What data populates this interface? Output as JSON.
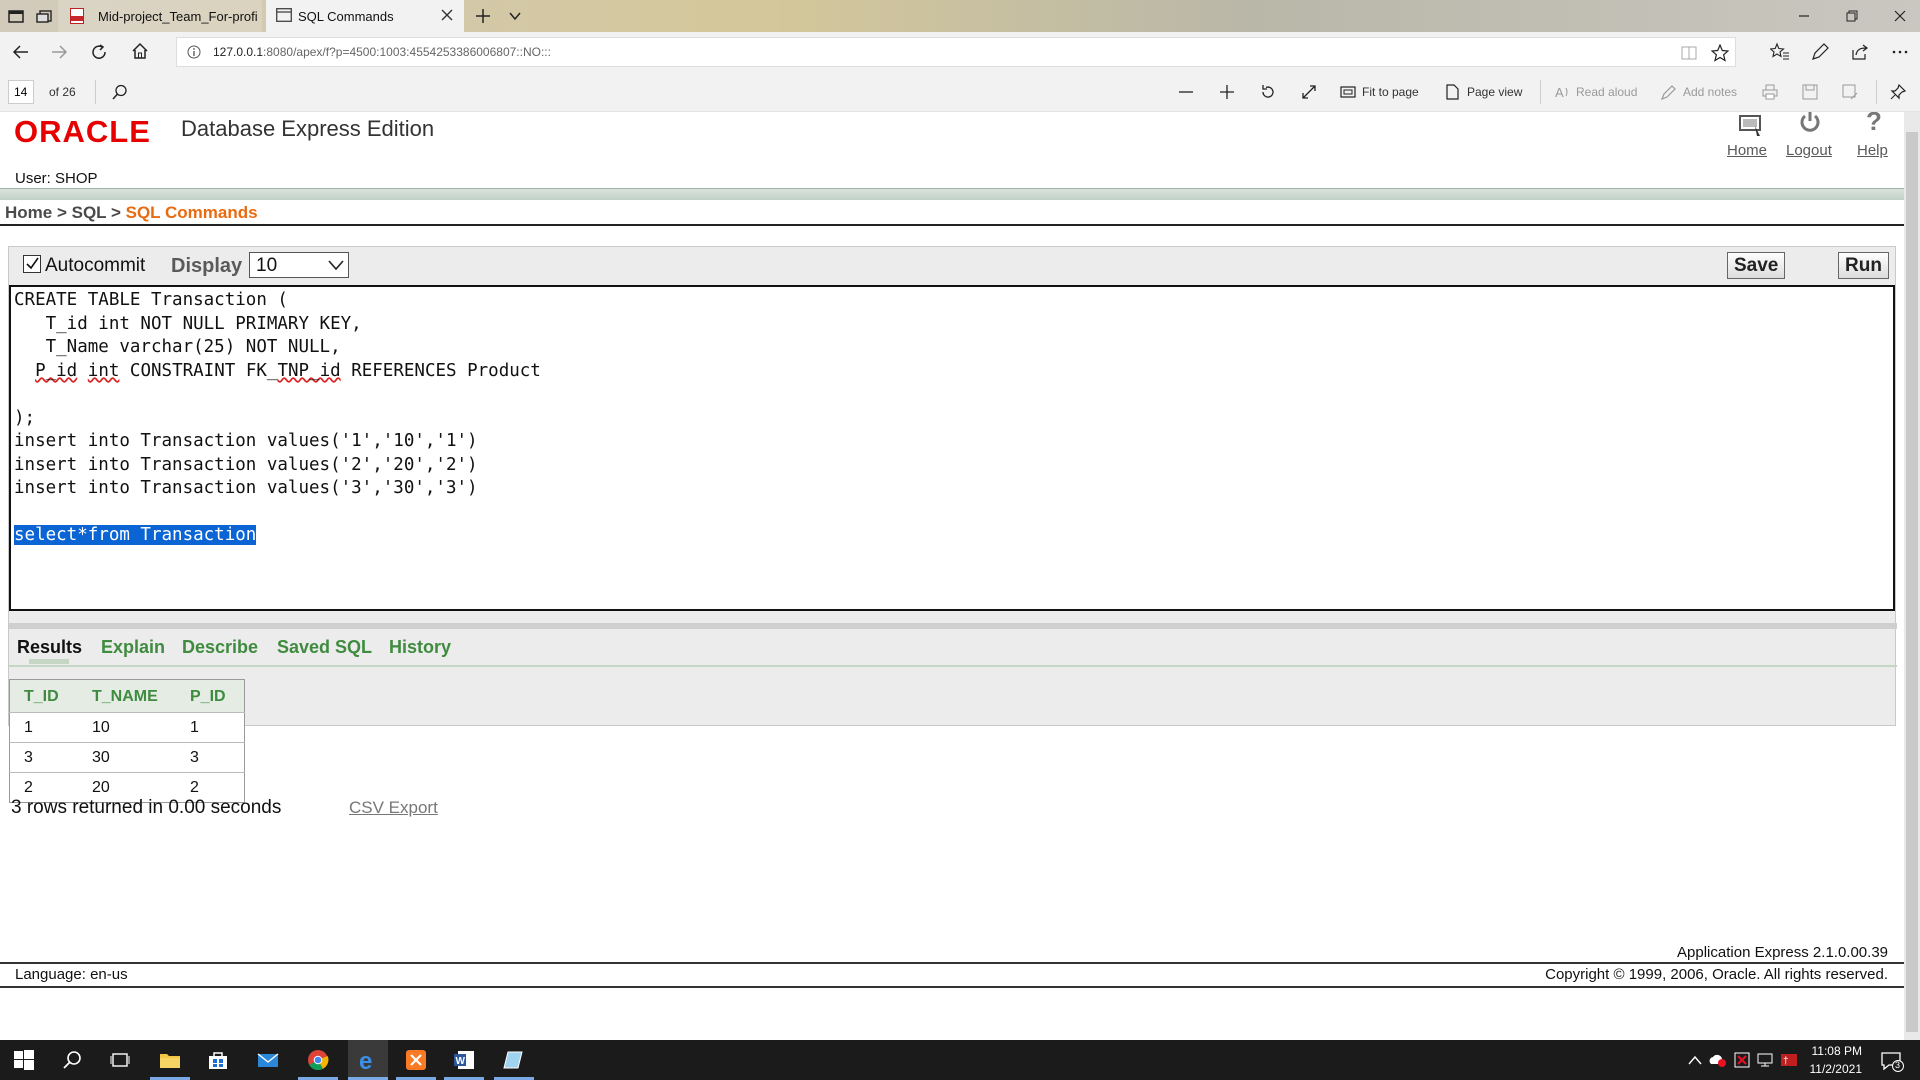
{
  "browser": {
    "tabs": [
      {
        "label": "Mid-project_Team_For-profi"
      },
      {
        "label": "SQL Commands"
      }
    ],
    "url_host": "127.0.0.1",
    "url_rest": ":8080/apex/f?p=4500:1003:4554253386006807::NO:::"
  },
  "pdf_toolbar": {
    "page": "14",
    "of_pages": "of 26",
    "fit_to_page": "Fit to page",
    "page_view": "Page view",
    "read_aloud": "Read aloud",
    "add_notes": "Add notes"
  },
  "header": {
    "logo": "ORACLE",
    "product": "Database Express Edition",
    "links": {
      "home": "Home",
      "logout": "Logout",
      "help": "Help"
    },
    "user": "User: SHOP"
  },
  "breadcrumb": {
    "home": "Home",
    "sep": " > ",
    "sql": "SQL",
    "current": "SQL Commands"
  },
  "command_panel": {
    "autocommit_label": "Autocommit",
    "autocommit_checked": true,
    "display_label": "Display",
    "display_value": "10",
    "save_label": "Save",
    "run_label": "Run",
    "code": {
      "line1": "CREATE TABLE Transaction (",
      "line2": "   T_id int NOT NULL PRIMARY KEY,",
      "line3": "   T_Name varchar(25) NOT NULL,",
      "line4_a": "  ",
      "line4_p_id": "P_id",
      "line4_sp": " ",
      "line4_int": "int",
      "line4_mid": " CONSTRAINT FK_",
      "line4_tnp": "TNP_id",
      "line4_end": " REFERENCES Product",
      "line5": ");",
      "line6": "insert into Transaction values('1','10','1')",
      "line7": "insert into Transaction values('2','20','2')",
      "line8": "insert into Transaction values('3','30','3')",
      "line9": "select*from Transaction"
    }
  },
  "results_tabs": {
    "results": "Results",
    "explain": "Explain",
    "describe": "Describe",
    "saved_sql": "Saved SQL",
    "history": "History"
  },
  "results": {
    "columns": [
      "T_ID",
      "T_NAME",
      "P_ID"
    ],
    "rows": [
      [
        "1",
        "10",
        "1"
      ],
      [
        "3",
        "30",
        "3"
      ],
      [
        "2",
        "20",
        "2"
      ]
    ],
    "summary": "3 rows returned in 0.00 seconds",
    "csv_export": "CSV Export"
  },
  "footer": {
    "app_version": "Application Express 2.1.0.00.39",
    "language": "Language: en-us",
    "copyright": "Copyright © 1999, 2006, Oracle. All rights reserved."
  },
  "taskbar": {
    "time": "11:08 PM",
    "date": "11/2/2021",
    "notifications": "3"
  },
  "colors": {
    "oracle_red": "#e60000",
    "crumb_orange": "#e96b10",
    "tab_green": "#3f8b3f",
    "selection_blue": "#0a64d4"
  }
}
